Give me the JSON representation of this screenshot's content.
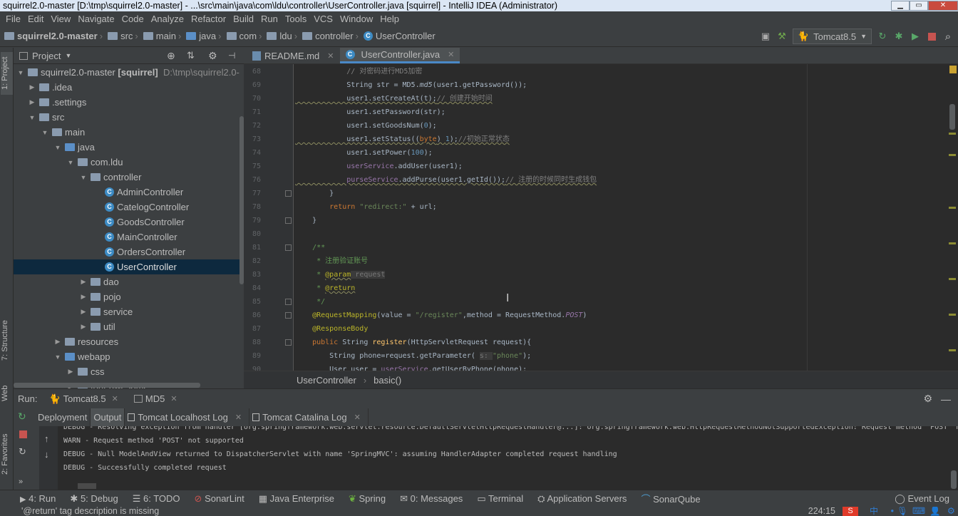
{
  "window": {
    "title": "squirrel2.0-master [D:\\tmp\\squirrel2.0-master] - ...\\src\\main\\java\\com\\ldu\\controller\\UserController.java [squirrel] - IntelliJ IDEA (Administrator)"
  },
  "menu": [
    "File",
    "Edit",
    "View",
    "Navigate",
    "Code",
    "Analyze",
    "Refactor",
    "Build",
    "Run",
    "Tools",
    "VCS",
    "Window",
    "Help"
  ],
  "breadcrumb": [
    "squirrel2.0-master",
    "src",
    "main",
    "java",
    "com",
    "ldu",
    "controller",
    "UserController"
  ],
  "toolbar": {
    "run_config": "Tomcat8.5"
  },
  "project_panel": {
    "title": "Project",
    "tree": [
      {
        "label": "squirrel2.0-master",
        "bold": "[squirrel]",
        "path": "D:\\tmp\\squirrel2.0-"
      },
      {
        "label": ".idea"
      },
      {
        "label": ".settings"
      },
      {
        "label": "src"
      },
      {
        "label": "main"
      },
      {
        "label": "java"
      },
      {
        "label": "com.ldu"
      },
      {
        "label": "controller"
      },
      {
        "label": "AdminController"
      },
      {
        "label": "CatelogController"
      },
      {
        "label": "GoodsController"
      },
      {
        "label": "MainController"
      },
      {
        "label": "OrdersController"
      },
      {
        "label": "UserController"
      },
      {
        "label": "dao"
      },
      {
        "label": "pojo"
      },
      {
        "label": "service"
      },
      {
        "label": "util"
      },
      {
        "label": "resources"
      },
      {
        "label": "webapp"
      },
      {
        "label": "css"
      },
      {
        "label": "font-awesome"
      }
    ]
  },
  "side_tabs": {
    "project": "1: Project",
    "structure": "7: Structure",
    "web": "Web",
    "favorites": "2: Favorites"
  },
  "editor": {
    "tabs": [
      "README.md",
      "UserController.java"
    ],
    "line_numbers": [
      "68",
      "69",
      "70",
      "71",
      "72",
      "73",
      "74",
      "75",
      "76",
      "77",
      "78",
      "79",
      "80",
      "81",
      "82",
      "83",
      "84",
      "85",
      "86",
      "87",
      "88",
      "89",
      "90"
    ],
    "lines": [
      {
        "parts": [
          [
            "cm",
            "            // 对密码进行MD5加密"
          ]
        ]
      },
      {
        "parts": [
          [
            "",
            "            String str = MD5."
          ],
          [
            "it",
            "md5"
          ],
          [
            "",
            "(user1.getPassword());"
          ]
        ]
      },
      {
        "parts": [
          [
            "",
            "            user1.setCreateAt(t);"
          ],
          [
            "cm",
            "// 创建开始时间"
          ]
        ]
      },
      {
        "parts": [
          [
            "",
            "            user1.setPassword(str);"
          ]
        ]
      },
      {
        "parts": [
          [
            "",
            "            user1.setGoodsNum("
          ],
          [
            "num",
            "0"
          ],
          [
            "",
            ");"
          ]
        ]
      },
      {
        "parts": [
          [
            "",
            "            user1.setStatus(("
          ],
          [
            "kw",
            "byte"
          ],
          [
            "",
            ") "
          ],
          [
            "num",
            "1"
          ],
          [
            "",
            ");"
          ],
          [
            "cm",
            "//初始正常状态"
          ]
        ]
      },
      {
        "parts": [
          [
            "",
            "            user1.setPower("
          ],
          [
            "num",
            "100"
          ],
          [
            "",
            ");"
          ]
        ]
      },
      {
        "parts": [
          [
            "fld",
            "            userService"
          ],
          [
            "",
            ".addUser(user1);"
          ]
        ]
      },
      {
        "parts": [
          [
            "fld",
            "            purseService"
          ],
          [
            "",
            ".addPurse(user1.getId());"
          ],
          [
            "cm",
            "// 注册的时候同时生成钱包"
          ]
        ]
      },
      {
        "parts": [
          [
            "",
            "        }"
          ]
        ]
      },
      {
        "parts": [
          [
            "kw",
            "        return "
          ],
          [
            "str",
            "\"redirect:\""
          ],
          [
            "",
            " + url;"
          ]
        ]
      },
      {
        "parts": [
          [
            "",
            "    }"
          ]
        ]
      },
      {
        "parts": [
          [
            "",
            ""
          ]
        ]
      },
      {
        "parts": [
          [
            "dcm",
            "    /**"
          ]
        ]
      },
      {
        "parts": [
          [
            "dcm",
            "     * 注册验证账号"
          ]
        ]
      },
      {
        "parts": [
          [
            "dcm",
            "     * "
          ],
          [
            "dtag",
            "@param"
          ],
          [
            "hint",
            " request"
          ]
        ]
      },
      {
        "parts": [
          [
            "dcm",
            "     * "
          ],
          [
            "dtag",
            "@return"
          ]
        ]
      },
      {
        "parts": [
          [
            "dcm",
            "     */"
          ]
        ]
      },
      {
        "parts": [
          [
            "ann",
            "    @RequestMapping"
          ],
          [
            "",
            "(value = "
          ],
          [
            "str",
            "\"/register\""
          ],
          [
            "",
            ",method = RequestMethod."
          ],
          [
            "fldi",
            "POST"
          ],
          [
            "",
            ")"
          ]
        ]
      },
      {
        "parts": [
          [
            "ann",
            "    @ResponseBody"
          ]
        ]
      },
      {
        "parts": [
          [
            "kw",
            "    public "
          ],
          [
            "",
            "String "
          ],
          [
            "fn",
            "register"
          ],
          [
            "",
            "(HttpServletRequest request){"
          ]
        ]
      },
      {
        "parts": [
          [
            "",
            "        String phone=request.getParameter( "
          ],
          [
            "hint",
            "s: "
          ],
          [
            "str",
            "\"phone\""
          ],
          [
            "",
            ");"
          ]
        ]
      },
      {
        "parts": [
          [
            "",
            "        User user = "
          ],
          [
            "fld",
            "userService"
          ],
          [
            "",
            ".getUserByPhone(phone);"
          ]
        ]
      }
    ],
    "method_crumb": [
      "UserController",
      "basic()"
    ]
  },
  "run_panel": {
    "label": "Run:",
    "tabs": [
      "Tomcat8.5",
      "MD5"
    ],
    "subtabs": [
      "Deployment",
      "Output",
      "Tomcat Localhost Log",
      "Tomcat Catalina Log"
    ],
    "console": [
      "DEBUG - Resolving exception from handler [org.springframework.web.servlet.resource.DefaultServletHttpRequestHandler@...]: org.springframework.web.HttpRequestMethodNotSupportedException: Request method 'POST' not",
      "WARN - Request method 'POST' not supported",
      "DEBUG - Null ModelAndView returned to DispatcherServlet with name 'SpringMVC': assuming HandlerAdapter completed request handling",
      "DEBUG - Successfully completed request"
    ]
  },
  "bottom_tools": [
    "4: Run",
    "5: Debug",
    "6: TODO",
    "SonarLint",
    "Java Enterprise",
    "Spring",
    "0: Messages",
    "Terminal",
    "Application Servers",
    "SonarQube"
  ],
  "event_log": "Event Log",
  "status": {
    "message": "'@return' tag description is missing",
    "position": "224:15"
  },
  "colors": {
    "accent": "#4a88c7",
    "selection": "#0d293e",
    "editor_bg": "#2b2b2b"
  }
}
